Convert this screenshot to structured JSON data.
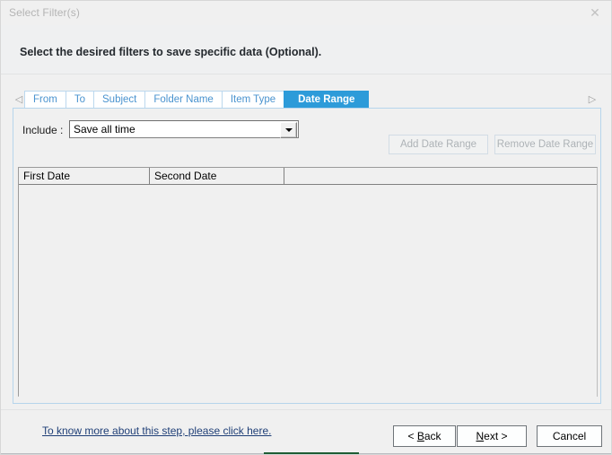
{
  "window": {
    "title": "Select Filter(s)",
    "close_icon": "close-icon",
    "close_glyph": "✕"
  },
  "header": {
    "instruction": "Select the desired filters to save specific data (Optional)."
  },
  "tabstrip": {
    "scroll_left_glyph": "◁",
    "scroll_right_glyph": "▷",
    "tabs": [
      {
        "label": "From",
        "active": false
      },
      {
        "label": "To",
        "active": false
      },
      {
        "label": "Subject",
        "active": false
      },
      {
        "label": "Folder Name",
        "active": false
      },
      {
        "label": "Item Type",
        "active": false
      },
      {
        "label": "Date Range",
        "active": true
      }
    ]
  },
  "panel": {
    "include_label": "Include :",
    "include_value": "Save all time",
    "include_options": [
      "Save all time"
    ],
    "add_button": "Add Date Range",
    "remove_button": "Remove Date Range",
    "buttons_disabled": true,
    "grid": {
      "columns": [
        "First Date",
        "Second Date",
        ""
      ],
      "rows": []
    }
  },
  "footer": {
    "help_link": "To know more about this step, please click here.",
    "back_button_pre": "< ",
    "back_button_key": "B",
    "back_button_post": "ack",
    "next_button_key": "N",
    "next_button_post": "ext >",
    "cancel_button": "Cancel"
  },
  "colors": {
    "accent_blue": "#2d9bd9",
    "tab_text_blue": "#4a93cf",
    "link_blue": "#1f3f77",
    "dialog_bg": "#f0f0f0",
    "disabled_text": "#adb2b6",
    "title_text": "#b4b4b4",
    "bottom_accent_green": "#1f5d34"
  }
}
